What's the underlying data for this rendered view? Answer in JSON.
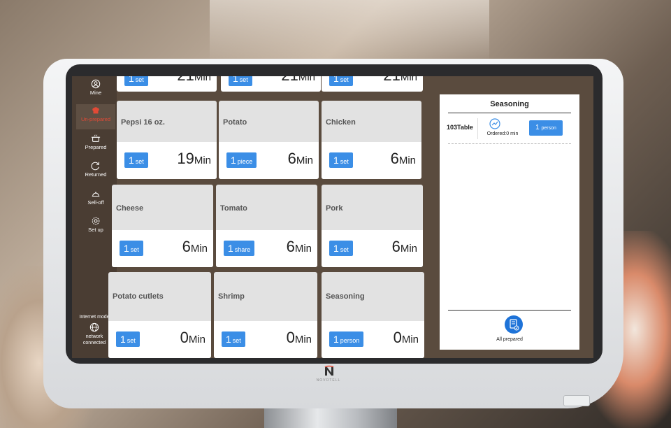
{
  "sidebar": {
    "items": [
      {
        "label": "Mine",
        "icon": "user-icon"
      },
      {
        "label": "Un-prepared",
        "icon": "chef-icon"
      },
      {
        "label": "Prepared",
        "icon": "pot-icon"
      },
      {
        "label": "Returned",
        "icon": "return-icon"
      },
      {
        "label": "Sell-off",
        "icon": "cloche-icon"
      },
      {
        "label": "Set up",
        "icon": "gear-icon"
      }
    ],
    "network": {
      "mode": "Internet mode",
      "status_line1": "network",
      "status_line2": "connected"
    }
  },
  "peek_cards": [
    {
      "qty": "1",
      "unit": "set",
      "minutes": "21",
      "min_label": "Min"
    },
    {
      "qty": "1",
      "unit": "set",
      "minutes": "21",
      "min_label": "Min"
    },
    {
      "qty": "1",
      "unit": "set",
      "minutes": "21",
      "min_label": "Min"
    }
  ],
  "cards": [
    {
      "name": "Pepsi 16 oz.",
      "qty": "1",
      "unit": "set",
      "minutes": "19",
      "min_label": "Min"
    },
    {
      "name": "Potato",
      "qty": "1",
      "unit": "piece",
      "minutes": "6",
      "min_label": "Min"
    },
    {
      "name": "Chicken",
      "qty": "1",
      "unit": "set",
      "minutes": "6",
      "min_label": "Min"
    },
    {
      "name": "Cheese",
      "qty": "1",
      "unit": "set",
      "minutes": "6",
      "min_label": "Min"
    },
    {
      "name": "Tomato",
      "qty": "1",
      "unit": "share",
      "minutes": "6",
      "min_label": "Min"
    },
    {
      "name": "Pork",
      "qty": "1",
      "unit": "set",
      "minutes": "6",
      "min_label": "Min"
    },
    {
      "name": "Potato cutlets",
      "qty": "1",
      "unit": "set",
      "minutes": "0",
      "min_label": "Min"
    },
    {
      "name": "Shrimp",
      "qty": "1",
      "unit": "set",
      "minutes": "0",
      "min_label": "Min"
    },
    {
      "name": "Seasoning",
      "qty": "1",
      "unit": "person",
      "minutes": "0",
      "min_label": "Min"
    }
  ],
  "panel": {
    "title": "Seasoning",
    "order": {
      "table": "103Table",
      "ordered": "Ordered:0 min",
      "qty": "1",
      "unit": "person"
    },
    "all_prepared_label": "All prepared"
  },
  "brand": {
    "logo_text": "NOVOTELL"
  },
  "colors": {
    "accent": "#3b8ee6",
    "active": "#e24a36",
    "button": "#1e73d8"
  }
}
